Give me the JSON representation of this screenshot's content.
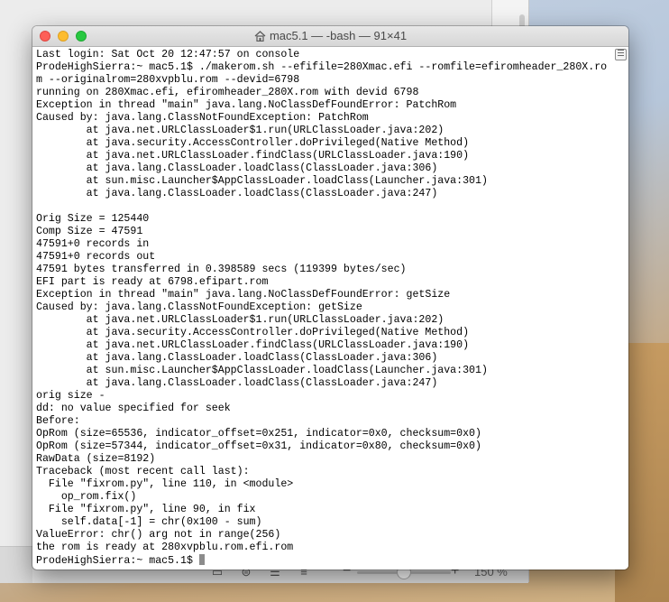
{
  "background_app": {
    "zoom_label": "150 %",
    "zoom_level_percent": 150
  },
  "terminal": {
    "title": "mac5.1 — -bash — 91×41",
    "lines": [
      "Last login: Sat Oct 20 12:47:57 on console",
      "ProdeHighSierra:~ mac5.1$ ./makerom.sh --efifile=280Xmac.efi --romfile=efiromheader_280X.ro",
      "m --originalrom=280xvpblu.rom --devid=6798",
      "running on 280Xmac.efi, efiromheader_280X.rom with devid 6798",
      "Exception in thread \"main\" java.lang.NoClassDefFoundError: PatchRom",
      "Caused by: java.lang.ClassNotFoundException: PatchRom",
      "        at java.net.URLClassLoader$1.run(URLClassLoader.java:202)",
      "        at java.security.AccessController.doPrivileged(Native Method)",
      "        at java.net.URLClassLoader.findClass(URLClassLoader.java:190)",
      "        at java.lang.ClassLoader.loadClass(ClassLoader.java:306)",
      "        at sun.misc.Launcher$AppClassLoader.loadClass(Launcher.java:301)",
      "        at java.lang.ClassLoader.loadClass(ClassLoader.java:247)",
      "",
      "Orig Size = 125440",
      "Comp Size = 47591",
      "47591+0 records in",
      "47591+0 records out",
      "47591 bytes transferred in 0.398589 secs (119399 bytes/sec)",
      "EFI part is ready at 6798.efipart.rom",
      "Exception in thread \"main\" java.lang.NoClassDefFoundError: getSize",
      "Caused by: java.lang.ClassNotFoundException: getSize",
      "        at java.net.URLClassLoader$1.run(URLClassLoader.java:202)",
      "        at java.security.AccessController.doPrivileged(Native Method)",
      "        at java.net.URLClassLoader.findClass(URLClassLoader.java:190)",
      "        at java.lang.ClassLoader.loadClass(ClassLoader.java:306)",
      "        at sun.misc.Launcher$AppClassLoader.loadClass(Launcher.java:301)",
      "        at java.lang.ClassLoader.loadClass(ClassLoader.java:247)",
      "orig size -",
      "dd: no value specified for seek",
      "Before:",
      "OpRom (size=65536, indicator_offset=0x251, indicator=0x0, checksum=0x0)",
      "OpRom (size=57344, indicator_offset=0x31, indicator=0x80, checksum=0x0)",
      "RawData (size=8192)",
      "Traceback (most recent call last):",
      "  File \"fixrom.py\", line 110, in <module>",
      "    op_rom.fix()",
      "  File \"fixrom.py\", line 90, in fix",
      "    self.data[-1] = chr(0x100 - sum)",
      "ValueError: chr() arg not in range(256)",
      "the rom is ready at 280xvpblu.rom.efi.rom"
    ],
    "prompt": "ProdeHighSierra:~ mac5.1$ "
  }
}
